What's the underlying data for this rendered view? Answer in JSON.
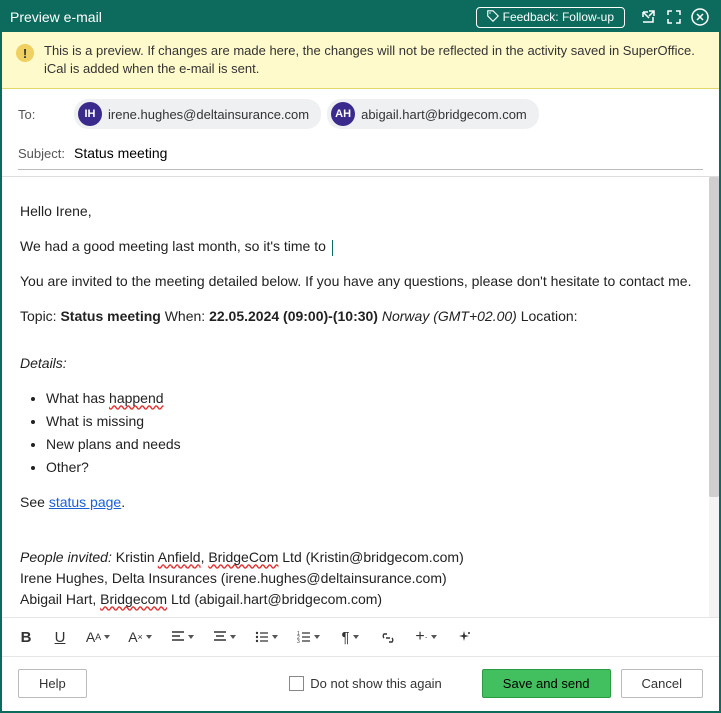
{
  "titlebar": {
    "title": "Preview e-mail",
    "feedback_label": "Feedback: Follow-up"
  },
  "warning": {
    "text": "This is a preview. If changes are made here, the changes will not be reflected in the activity saved in SuperOffice. iCal is added when the e-mail is sent."
  },
  "fields": {
    "to_label": "To:",
    "subject_label": "Subject:",
    "subject_value": "Status meeting",
    "recipients": [
      {
        "initials": "IH",
        "email": "irene.hughes@deltainsurance.com"
      },
      {
        "initials": "AH",
        "email": "abigail.hart@bridgecom.com"
      }
    ]
  },
  "body": {
    "greeting": "Hello Irene,",
    "line2": "We had a good meeting last month, so it's time to ",
    "line3": "You are invited to the meeting detailed below. If you have any questions, please don't hesitate to contact me.",
    "topic_label": "Topic: ",
    "topic_value": "Status meeting",
    "when_label": " When: ",
    "when_value": "22.05.2024 (09:00)-(10:30)",
    "tz": " Norway (GMT+02.00)",
    "location_label": " Location:",
    "details_label": "Details:",
    "bullets": [
      {
        "pre": "What has ",
        "err": "happend"
      },
      {
        "text": "What is missing"
      },
      {
        "text": "New plans and needs"
      },
      {
        "text": "Other?"
      }
    ],
    "see_label": "See ",
    "link_text": "status page",
    "people_label": "People invited:",
    "p1_pre": " Kristin ",
    "p1_err": "Anfield",
    "p1_post": ", ",
    "p1_err2": "BridgeCom",
    "p1_rest": " Ltd (Kristin@bridgecom.com)",
    "p2": "Irene Hughes, Delta Insurances (irene.hughes@deltainsurance.com)",
    "p3_pre": "Abigail Hart, ",
    "p3_err": "Bridgecom",
    "p3_rest": " Ltd (abigail.hart@bridgecom.com)"
  },
  "footer": {
    "help": "Help",
    "dont_show": "Do not show this again",
    "save_send": "Save and send",
    "cancel": "Cancel"
  }
}
